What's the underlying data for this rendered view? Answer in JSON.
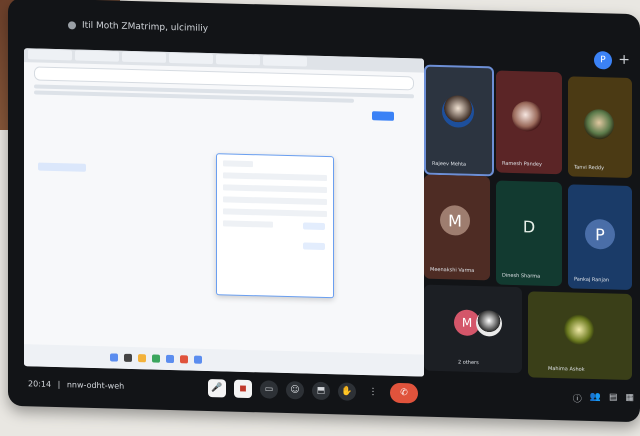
{
  "window": {
    "title": "Itil Moth ZMatrimp, ulcimiliy"
  },
  "meeting": {
    "time": "20:14",
    "code": "nnw-odht-weh"
  },
  "participants": [
    {
      "name": "Rajeev Mehta"
    },
    {
      "name": "Ramesh Pandey"
    },
    {
      "name": "Tanvi Reddy"
    },
    {
      "name": "Meenakshi Varma",
      "initial": "M"
    },
    {
      "name": "Dinesh Sharma",
      "initial": "D"
    },
    {
      "name": "Pankaj Ranjan",
      "initial": "P"
    },
    {
      "name": "2 others",
      "initial": "M"
    },
    {
      "name": "Mahima Ashok"
    }
  ],
  "top_avatar": {
    "initial": "P"
  },
  "icons": {
    "mic": "mic-off-icon",
    "camera": "camera-off-icon",
    "captions": "captions-icon",
    "emoji": "emoji-icon",
    "present": "present-icon",
    "hand": "raise-hand-icon",
    "more": "more-icon",
    "leave": "leave-call-icon"
  },
  "colors": {
    "leave": "#e0533c",
    "accent": "#3b82f6"
  }
}
